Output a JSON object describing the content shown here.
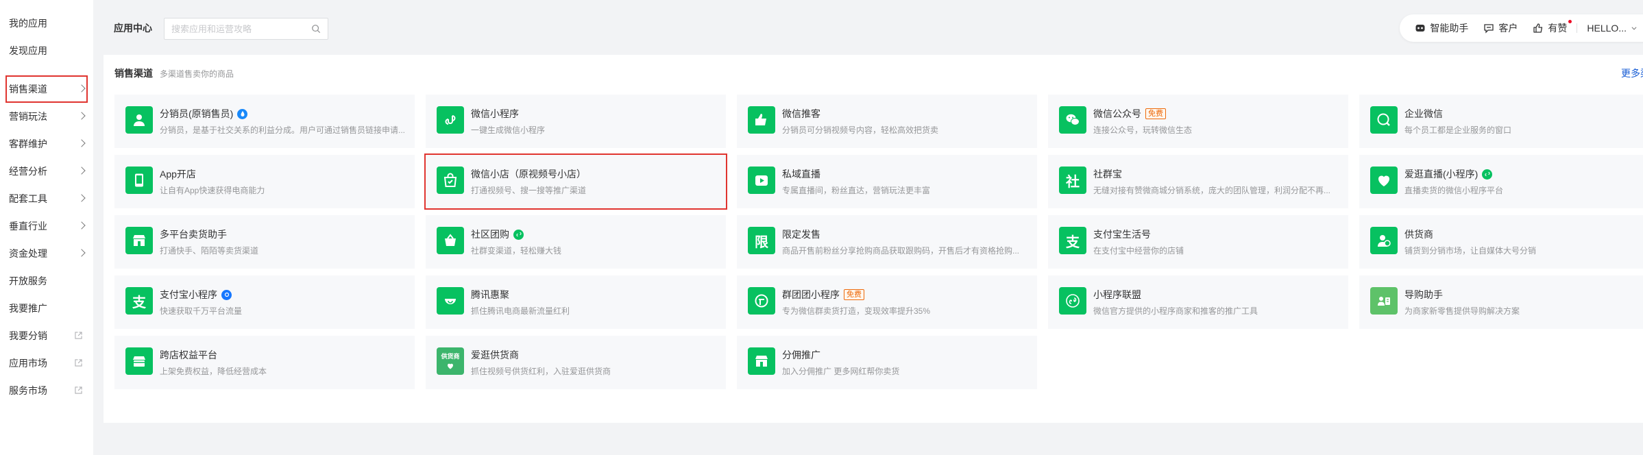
{
  "sidebar": {
    "top_items": [
      {
        "label": "我的应用"
      },
      {
        "label": "发现应用"
      }
    ],
    "items": [
      {
        "label": "销售渠道"
      },
      {
        "label": "营销玩法"
      },
      {
        "label": "客群维护"
      },
      {
        "label": "经营分析"
      },
      {
        "label": "配套工具"
      },
      {
        "label": "垂直行业"
      },
      {
        "label": "资金处理"
      },
      {
        "label": "开放服务"
      },
      {
        "label": "我要推广"
      },
      {
        "label": "我要分销"
      },
      {
        "label": "应用市场"
      },
      {
        "label": "服务市场"
      }
    ]
  },
  "header": {
    "title": "应用中心",
    "search_placeholder": "搜索应用和运营攻略"
  },
  "toolbar": {
    "assistant": "智能助手",
    "customer": "客户",
    "youzan": "有赞",
    "user": "HELLO..."
  },
  "section": {
    "title": "销售渠道",
    "subtitle": "多渠道售卖你的商品",
    "more": "更多渠"
  },
  "badges": {
    "free": "免费"
  },
  "cards": [
    {
      "name": "分销员(原销售员)",
      "desc": "分销员，是基于社交关系的利益分成。用户可通过销售员链接申请..."
    },
    {
      "name": "微信小程序",
      "desc": "一键生成微信小程序"
    },
    {
      "name": "微信推客",
      "desc": "分销员可分销视频号内容，轻松高效把货卖"
    },
    {
      "name": "微信公众号",
      "desc": "连接公众号，玩转微信生态"
    },
    {
      "name": "企业微信",
      "desc": "每个员工都是企业服务的窗口"
    },
    {
      "name": "App开店",
      "desc": "让自有App快速获得电商能力"
    },
    {
      "name": "微信小店（原视频号小店）",
      "desc": "打通视频号、搜一搜等推广渠道"
    },
    {
      "name": "私域直播",
      "desc": "专属直播间，粉丝直达，营销玩法更丰富"
    },
    {
      "name": "社群宝",
      "desc": "无缝对接有赞微商城分销系统，庞大的团队管理，利润分配不再..."
    },
    {
      "name": "爱逛直播(小程序)",
      "desc": "直播卖货的微信小程序平台"
    },
    {
      "name": "多平台卖货助手",
      "desc": "打通快手、陌陌等卖货渠道"
    },
    {
      "name": "社区团购",
      "desc": "社群变渠道，轻松赚大钱"
    },
    {
      "name": "限定发售",
      "desc": "商品开售前粉丝分享抢购商品获取跟购码，开售后才有资格抢购..."
    },
    {
      "name": "支付宝生活号",
      "desc": "在支付宝中经营你的店铺"
    },
    {
      "name": "供货商",
      "desc": "铺货到分销市场，让自媒体大号分销"
    },
    {
      "name": "支付宝小程序",
      "desc": "快速获取千万平台流量"
    },
    {
      "name": "腾讯惠聚",
      "desc": "抓住腾讯电商最新流量红利"
    },
    {
      "name": "群团团小程序",
      "desc": "专为微信群卖货打造，变现效率提升35%"
    },
    {
      "name": "小程序联盟",
      "desc": "微信官方提供的小程序商家和推客的推广工具"
    },
    {
      "name": "导购助手",
      "desc": "为商家新零售提供导购解决方案"
    },
    {
      "name": "跨店权益平台",
      "desc": "上架免费权益，降低经营成本"
    },
    {
      "name": "爱逛供货商",
      "desc": "抓住视频号供货红利，入驻爱逛供货商"
    },
    {
      "name": "分佣推广",
      "desc": "加入分佣推广 更多网红帮你卖货"
    }
  ],
  "icon_glyphs": {
    "limited": "限",
    "shequn": "社",
    "alipay": "支",
    "supplier_tag": "供货商"
  },
  "colors": {
    "accent_green": "#07c160",
    "link_blue": "#155bd4",
    "highlight_red": "#e0342f",
    "free_orange": "#ed6a0c"
  }
}
